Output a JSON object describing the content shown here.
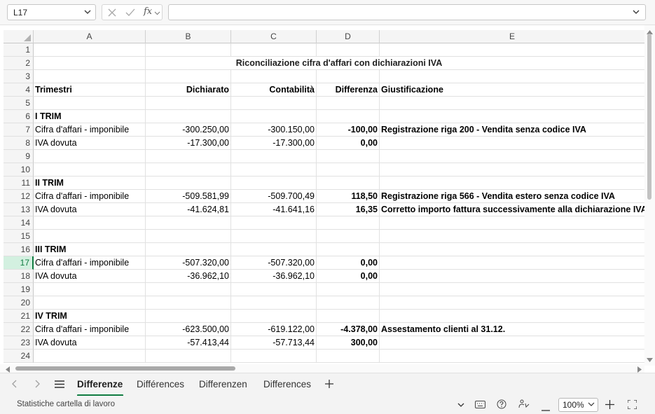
{
  "formula_bar": {
    "name_box": "L17",
    "fx_label": "fx",
    "formula": ""
  },
  "columns": [
    "A",
    "B",
    "C",
    "D",
    "E"
  ],
  "title": "Riconciliazione cifra d'affari con dichiarazioni IVA",
  "headers": {
    "a": "Trimestri",
    "b": "Dichiarato",
    "c": "Contabilità",
    "d": "Differenza",
    "e": "Giustificazione"
  },
  "rows": {
    "r6": {
      "a": "I TRIM"
    },
    "r7": {
      "a": "Cifra d'affari - imponibile",
      "b": "-300.250,00",
      "c": "-300.150,00",
      "d": "-100,00",
      "e": "Registrazione riga 200 - Vendita senza codice IVA"
    },
    "r8": {
      "a": "IVA dovuta",
      "b": "-17.300,00",
      "c": "-17.300,00",
      "d": "0,00",
      "e": ""
    },
    "r11": {
      "a": "II TRIM"
    },
    "r12": {
      "a": "Cifra d'affari - imponibile",
      "b": "-509.581,99",
      "c": "-509.700,49",
      "d": "118,50",
      "e": "Registrazione riga 566 - Vendita estero senza codice IVA"
    },
    "r13": {
      "a": "IVA dovuta",
      "b": "-41.624,81",
      "c": "-41.641,16",
      "d": "16,35",
      "e": "Corretto importo fattura successivamente alla dichiarazione IVA"
    },
    "r16": {
      "a": "III TRIM"
    },
    "r17": {
      "a": "Cifra d'affari - imponibile",
      "b": "-507.320,00",
      "c": "-507.320,00",
      "d": "0,00",
      "e": ""
    },
    "r18": {
      "a": "IVA dovuta",
      "b": "-36.962,10",
      "c": "-36.962,10",
      "d": "0,00",
      "e": ""
    },
    "r21": {
      "a": "IV TRIM"
    },
    "r22": {
      "a": "Cifra d'affari - imponibile",
      "b": "-623.500,00",
      "c": "-619.122,00",
      "d": "-4.378,00",
      "e": "Assestamento clienti al 31.12."
    },
    "r23": {
      "a": "IVA dovuta",
      "b": "-57.413,44",
      "c": "-57.713,44",
      "d": "300,00",
      "e": ""
    }
  },
  "active_row": 17,
  "sheet_tabs": [
    "Differenze",
    "Différences",
    "Differenzen",
    "Differences"
  ],
  "active_tab": "Differenze",
  "status_bar": {
    "label": "Statistiche cartella di lavoro",
    "zoom": "100%"
  },
  "colors": {
    "accent": "#107c41",
    "active_row_bg": "#d3f0e0"
  }
}
